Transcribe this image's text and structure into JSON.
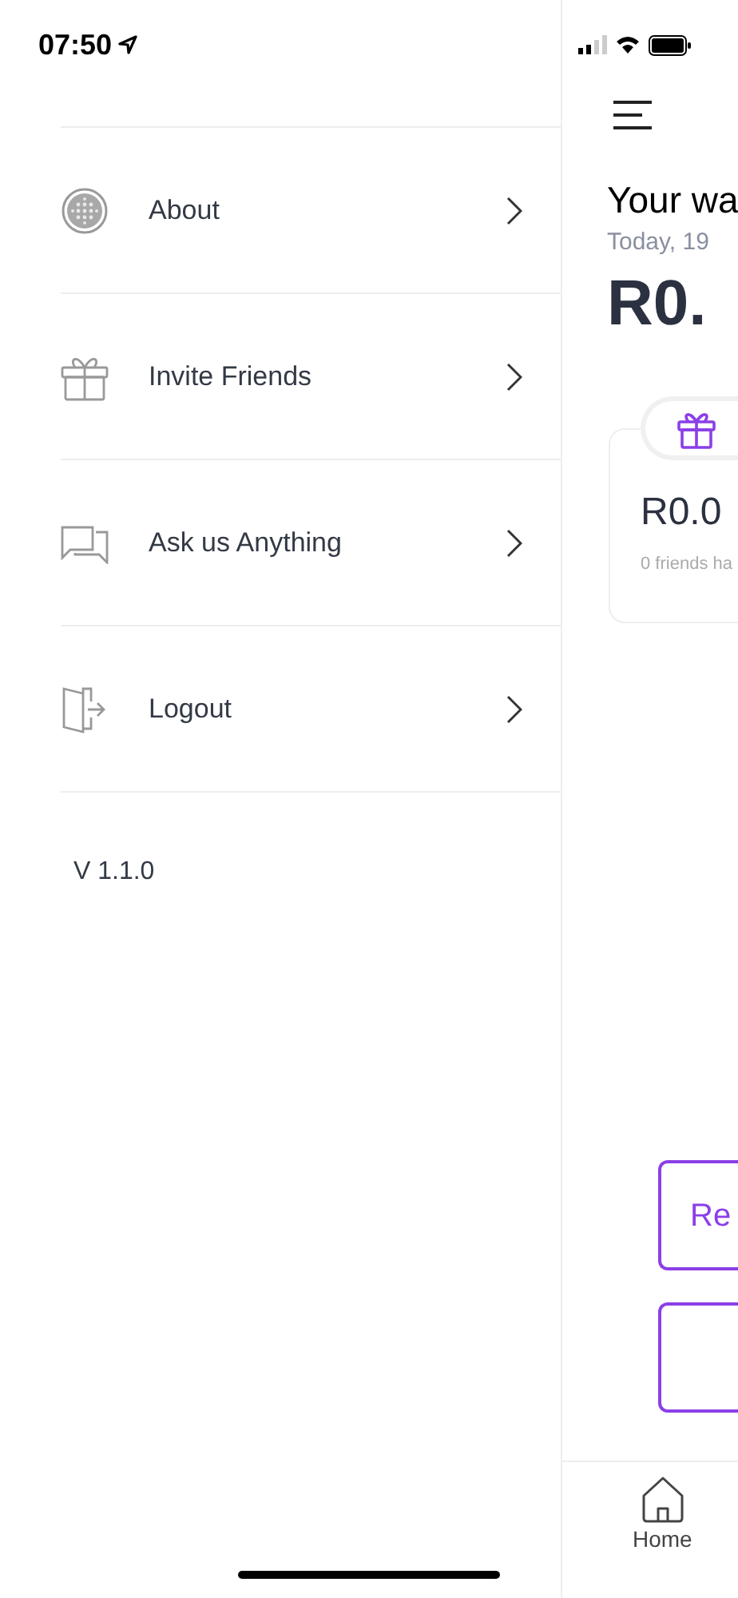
{
  "status_bar": {
    "time": "07:50"
  },
  "menu": {
    "items": [
      {
        "kind": "about",
        "label": "About"
      },
      {
        "kind": "gift",
        "label": "Invite Friends"
      },
      {
        "kind": "chat",
        "label": "Ask us Anything"
      },
      {
        "kind": "logout",
        "label": "Logout"
      }
    ],
    "version": "V 1.1.0"
  },
  "main": {
    "title": "Your wa",
    "date": "Today, 19",
    "balance": "R0.",
    "card": {
      "amount": "R0.0",
      "caption": "0 friends ha"
    },
    "buttons": [
      {
        "kind": "text",
        "label": "Re"
      },
      {
        "kind": "blank"
      }
    ]
  },
  "tab_bar": {
    "tabs": [
      {
        "label": "Home"
      }
    ]
  }
}
